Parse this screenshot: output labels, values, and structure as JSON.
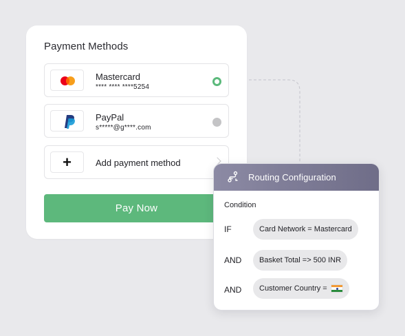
{
  "payment": {
    "title": "Payment Methods",
    "methods": [
      {
        "name": "Mastercard",
        "detail": "**** **** ****5254",
        "selected": true,
        "icon": "mastercard-logo-icon"
      },
      {
        "name": "PayPal",
        "detail": "s*****@g****.com",
        "selected": false,
        "icon": "paypal-logo-icon"
      }
    ],
    "add_label": "Add payment method",
    "pay_label": "Pay Now"
  },
  "routing": {
    "title": "Routing Configuration",
    "condition_label": "Condition",
    "rules": [
      {
        "op": "IF",
        "text": "Card Network = Mastercard"
      },
      {
        "op": "AND",
        "text": "Basket Total => 500 INR"
      },
      {
        "op": "AND",
        "text": "Customer Country =",
        "flag": "india-flag-icon"
      }
    ]
  },
  "colors": {
    "accent_green": "#5db87c",
    "header_purple": "#7d7b96",
    "background": "#e9e9ec"
  }
}
